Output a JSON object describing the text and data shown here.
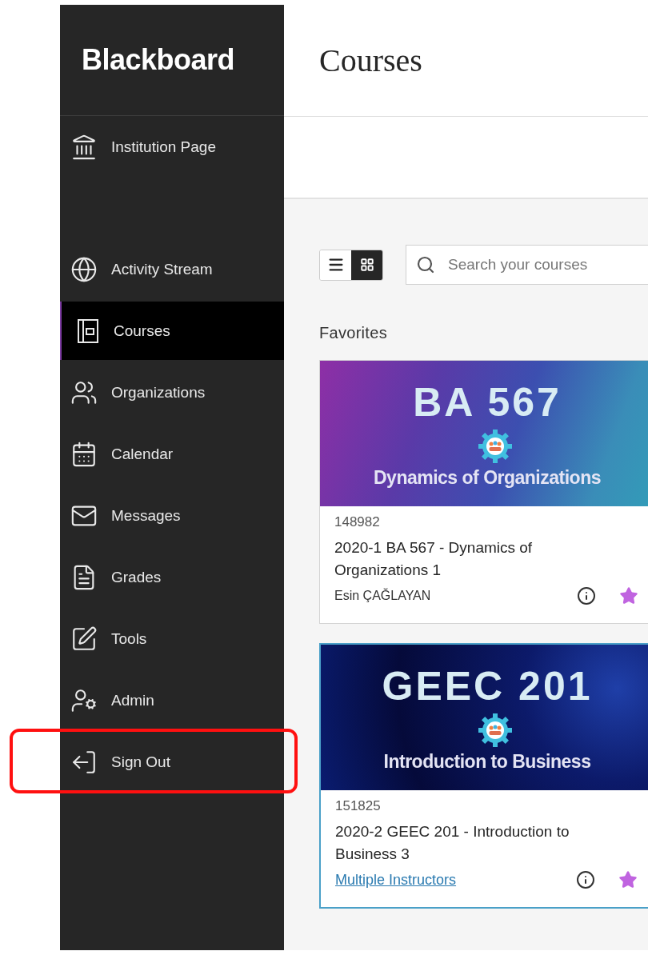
{
  "sidebar": {
    "logo": "Blackboard",
    "institution_link": {
      "label": "Institution Page"
    },
    "items": [
      {
        "label": "Activity Stream",
        "selected": false,
        "highlighted": false
      },
      {
        "label": "Courses",
        "selected": true,
        "highlighted": false
      },
      {
        "label": "Organizations",
        "selected": false,
        "highlighted": false
      },
      {
        "label": "Calendar",
        "selected": false,
        "highlighted": false
      },
      {
        "label": "Messages",
        "selected": false,
        "highlighted": false
      },
      {
        "label": "Grades",
        "selected": false,
        "highlighted": false
      },
      {
        "label": "Tools",
        "selected": false,
        "highlighted": false
      },
      {
        "label": "Admin",
        "selected": false,
        "highlighted": false
      },
      {
        "label": "Sign Out",
        "selected": false,
        "highlighted": true
      }
    ]
  },
  "header": {
    "title": "Courses"
  },
  "toolbar": {
    "views": [
      {
        "kind": "list",
        "selected": false
      },
      {
        "kind": "grid",
        "selected": true
      }
    ],
    "search": {
      "placeholder": "Search your courses"
    }
  },
  "favorites": {
    "heading": "Favorites",
    "courses": [
      {
        "banner_title": "BA 567",
        "banner_subtitle": "Dynamics of Organizations",
        "code": "148982",
        "title": "2020-1 BA 567 - Dynamics of Organizations 1",
        "instructor": {
          "kind": "text",
          "label": "Esin ÇAĞLAYAN"
        },
        "favorite": true,
        "focused": false
      },
      {
        "banner_title": "GEEC 201",
        "banner_subtitle": "Introduction to Business",
        "code": "151825",
        "title": "2020-2 GEEC 201 - Introduction to Business 3",
        "instructor": {
          "kind": "link",
          "label": "Multiple Instructors"
        },
        "favorite": true,
        "focused": true
      }
    ]
  }
}
